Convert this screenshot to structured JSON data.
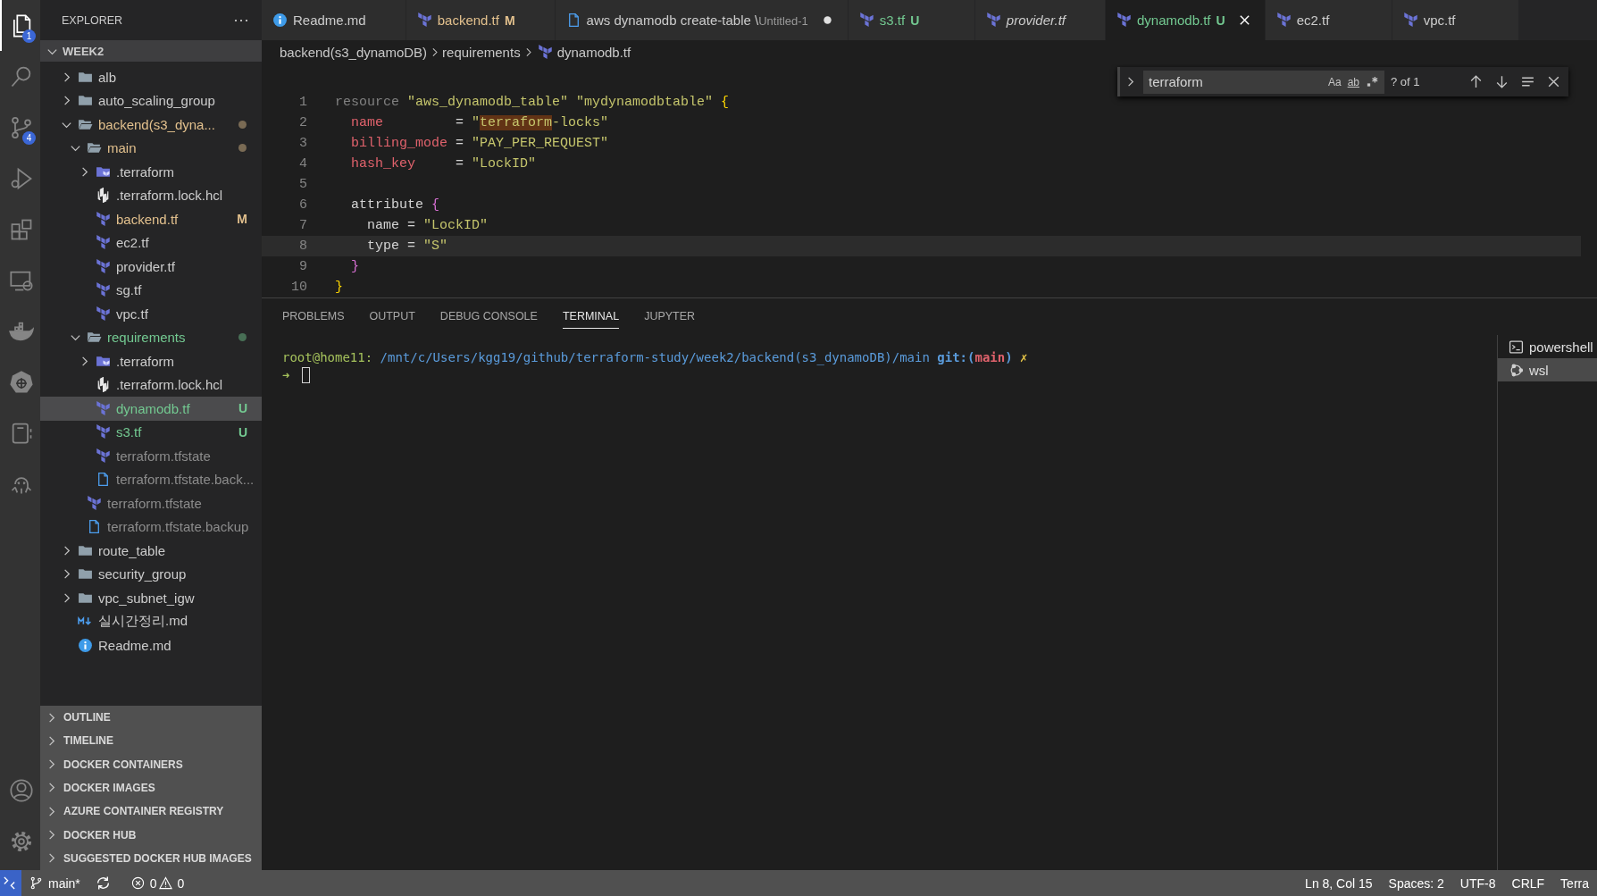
{
  "activity_bar": {
    "items": [
      {
        "kind": "explorer",
        "selected": true,
        "badge": "1"
      },
      {
        "kind": "search",
        "selected": false
      },
      {
        "kind": "source-control",
        "selected": false,
        "badge": "4"
      },
      {
        "kind": "run",
        "selected": false
      },
      {
        "kind": "extensions",
        "selected": false
      },
      {
        "kind": "remote",
        "selected": false
      },
      {
        "kind": "docker",
        "selected": false
      },
      {
        "kind": "kubernetes",
        "selected": false
      },
      {
        "kind": "notebook",
        "selected": false
      },
      {
        "kind": "octopus",
        "selected": false
      }
    ],
    "bottom": [
      {
        "kind": "account"
      },
      {
        "kind": "settings"
      }
    ]
  },
  "sidebar": {
    "title": "EXPLORER",
    "more": "···",
    "root": {
      "label": "WEEK2",
      "expanded": true
    },
    "tree": [
      {
        "label": "alb",
        "kind": "folder",
        "expanded": false,
        "color": "#cccccc",
        "dot": false,
        "selected": false
      },
      {
        "label": "auto_scaling_group",
        "kind": "folder",
        "expanded": false,
        "color": "#cccccc",
        "dot": false,
        "selected": false
      },
      {
        "label": "backend(s3_dyna...",
        "kind": "folder",
        "expanded": true,
        "color": "#e2c08d",
        "dot": true,
        "selected": false,
        "children": [
          {
            "label": "main",
            "kind": "folder",
            "expanded": true,
            "color": "#e2c08d",
            "dot": true,
            "selected": false,
            "children": [
              {
                "label": ".terraform",
                "kind": "tf-folder",
                "expanded": false,
                "color": "#cccccc",
                "dot": false,
                "selected": false
              },
              {
                "label": ".terraform.lock.hcl",
                "kind": "hcl",
                "color": "#cccccc",
                "selected": false
              },
              {
                "label": "backend.tf",
                "kind": "tf",
                "color": "#e2c08d",
                "badge": "M",
                "selected": false
              },
              {
                "label": "ec2.tf",
                "kind": "tf",
                "color": "#cccccc",
                "selected": false
              },
              {
                "label": "provider.tf",
                "kind": "tf",
                "color": "#cccccc",
                "selected": false
              },
              {
                "label": "sg.tf",
                "kind": "tf",
                "color": "#cccccc",
                "selected": false
              },
              {
                "label": "vpc.tf",
                "kind": "tf",
                "color": "#cccccc",
                "selected": false
              }
            ]
          },
          {
            "label": "requirements",
            "kind": "folder",
            "expanded": true,
            "color": "#73c991",
            "dot": true,
            "selected": false,
            "children": [
              {
                "label": ".terraform",
                "kind": "tf-folder",
                "expanded": false,
                "color": "#cccccc",
                "dot": false,
                "selected": false
              },
              {
                "label": ".terraform.lock.hcl",
                "kind": "hcl",
                "color": "#cccccc",
                "selected": false
              },
              {
                "label": "dynamodb.tf",
                "kind": "tf",
                "color": "#73c991",
                "badge": "U",
                "selected": true
              },
              {
                "label": "s3.tf",
                "kind": "tf",
                "color": "#73c991",
                "badge": "U",
                "selected": false
              },
              {
                "label": "terraform.tfstate",
                "kind": "tf",
                "color": "#8c8c8c",
                "selected": false
              },
              {
                "label": "terraform.tfstate.back...",
                "kind": "file",
                "color": "#8c8c8c",
                "selected": false
              }
            ]
          },
          {
            "label": "terraform.tfstate",
            "kind": "tf",
            "color": "#8c8c8c",
            "selected": false
          },
          {
            "label": "terraform.tfstate.backup",
            "kind": "file",
            "color": "#8c8c8c",
            "selected": false
          }
        ]
      },
      {
        "label": "route_table",
        "kind": "folder",
        "expanded": false,
        "color": "#cccccc",
        "dot": false,
        "selected": false
      },
      {
        "label": "security_group",
        "kind": "folder",
        "expanded": false,
        "color": "#cccccc",
        "dot": false,
        "selected": false
      },
      {
        "label": "vpc_subnet_igw",
        "kind": "folder",
        "expanded": false,
        "color": "#cccccc",
        "dot": false,
        "selected": false
      },
      {
        "label": "실시간정리.md",
        "kind": "markdown",
        "color": "#cccccc",
        "selected": false
      },
      {
        "label": "Readme.md",
        "kind": "info",
        "color": "#cccccc",
        "selected": false
      }
    ],
    "sections": [
      {
        "label": "OUTLINE",
        "expanded": false
      },
      {
        "label": "TIMELINE",
        "expanded": false
      },
      {
        "label": "DOCKER CONTAINERS",
        "expanded": false
      },
      {
        "label": "DOCKER IMAGES",
        "expanded": false
      },
      {
        "label": "AZURE CONTAINER REGISTRY",
        "expanded": false
      },
      {
        "label": "DOCKER HUB",
        "expanded": false
      },
      {
        "label": "SUGGESTED DOCKER HUB IMAGES",
        "expanded": false
      }
    ]
  },
  "tabs": [
    {
      "label": "Readme.md",
      "kind": "info",
      "color": "#cccccc",
      "selected": false,
      "dirty": false,
      "preview": false
    },
    {
      "label": "backend.tf",
      "kind": "tf",
      "color": "#e2c08d",
      "badge": "M",
      "selected": false,
      "dirty": false,
      "preview": false
    },
    {
      "label": "aws dynamodb create-table \\",
      "description": "Untitled-1",
      "kind": "file",
      "color": "#cccccc",
      "selected": false,
      "dirty": true,
      "preview": false
    },
    {
      "label": "s3.tf",
      "kind": "tf",
      "color": "#73c991",
      "badge": "U",
      "selected": false,
      "dirty": false,
      "preview": false
    },
    {
      "label": "provider.tf",
      "kind": "tf",
      "color": "#cccccc",
      "selected": false,
      "dirty": false,
      "preview": true
    },
    {
      "label": "dynamodb.tf",
      "kind": "tf",
      "color": "#73c991",
      "badge": "U",
      "selected": true,
      "dirty": false,
      "preview": false
    },
    {
      "label": "ec2.tf",
      "kind": "tf",
      "color": "#cccccc",
      "selected": false,
      "dirty": false,
      "preview": false
    },
    {
      "label": "vpc.tf",
      "kind": "tf",
      "color": "#cccccc",
      "selected": false,
      "dirty": false,
      "preview": false
    }
  ],
  "breadcrumb": [
    {
      "label": "backend(s3_dynamoDB)",
      "kind": "folder"
    },
    {
      "label": "requirements",
      "kind": "folder"
    },
    {
      "label": "dynamodb.tf",
      "kind": "tf"
    }
  ],
  "find": {
    "value": "terraform",
    "options": [
      {
        "label": "Aa",
        "kind": "case"
      },
      {
        "label": "ab",
        "kind": "word"
      }
    ],
    "count": "? of 1"
  },
  "editor": {
    "lines": [
      {
        "number": "1",
        "current": false,
        "tokens": [
          {
            "text": "resource",
            "kind": "keyword"
          },
          {
            "text": " \"aws_dynamodb_table\" \"mydynamodbtable\"",
            "kind": "string"
          },
          {
            "text": " {",
            "kind": "bracket1"
          }
        ]
      },
      {
        "number": "2",
        "current": false,
        "tokens": [
          {
            "text": "  name",
            "kind": "property"
          },
          {
            "text": "         = ",
            "kind": "plain"
          },
          {
            "text": "\"",
            "kind": "string"
          },
          {
            "text": "terraform",
            "kind": "match"
          },
          {
            "text": "-locks\"",
            "kind": "string"
          }
        ]
      },
      {
        "number": "3",
        "current": false,
        "tokens": [
          {
            "text": "  billing_mode",
            "kind": "property"
          },
          {
            "text": " = ",
            "kind": "plain"
          },
          {
            "text": "\"PAY_PER_REQUEST\"",
            "kind": "string"
          }
        ]
      },
      {
        "number": "4",
        "current": false,
        "tokens": [
          {
            "text": "  hash_key",
            "kind": "property"
          },
          {
            "text": "     = ",
            "kind": "plain"
          },
          {
            "text": "\"LockID\"",
            "kind": "string"
          }
        ]
      },
      {
        "number": "5",
        "current": false
      },
      {
        "number": "6",
        "current": false,
        "tokens": [
          {
            "text": "  attribute ",
            "kind": "plain"
          },
          {
            "text": "{",
            "kind": "bracket2"
          }
        ]
      },
      {
        "number": "7",
        "current": false,
        "tokens": [
          {
            "text": "    name = ",
            "kind": "plain"
          },
          {
            "text": "\"LockID\"",
            "kind": "string"
          }
        ]
      },
      {
        "number": "8",
        "current": true,
        "tokens": [
          {
            "text": "    type = ",
            "kind": "plain"
          },
          {
            "text": "\"S\"",
            "kind": "string"
          }
        ]
      },
      {
        "number": "9",
        "current": false,
        "tokens": [
          {
            "text": "  }",
            "kind": "bracket2"
          }
        ]
      },
      {
        "number": "10",
        "current": false,
        "tokens": [
          {
            "text": "}",
            "kind": "bracket1"
          }
        ]
      }
    ]
  },
  "panel": {
    "tabs": [
      {
        "label": "PROBLEMS",
        "selected": false
      },
      {
        "label": "OUTPUT",
        "selected": false
      },
      {
        "label": "DEBUG CONSOLE",
        "selected": false
      },
      {
        "label": "TERMINAL",
        "selected": true
      },
      {
        "label": "JUPYTER",
        "selected": false
      }
    ],
    "terminal": {
      "prompt_line": [
        {
          "text": "root@home11:",
          "kind": "user"
        },
        {
          "text": " /mnt/c/Users/kgg19/github/terraform-study/week2/backend(s3_dynamoDB)/main ",
          "kind": "path"
        },
        {
          "text": "git:(",
          "kind": "git"
        },
        {
          "text": "main",
          "kind": "branch"
        },
        {
          "text": ")",
          "kind": "git"
        },
        {
          "text": " ✗",
          "kind": "dirty"
        }
      ],
      "arrow": "➜"
    },
    "terminals": [
      {
        "label": "powershell",
        "kind": "powershell",
        "selected": false
      },
      {
        "label": "wsl",
        "kind": "wsl",
        "selected": true
      }
    ]
  },
  "status_bar": {
    "branch": "main*",
    "errors": "0",
    "warnings": "0",
    "right": [
      "Ln 8, Col 15",
      "Spaces: 2",
      "UTF-8",
      "CRLF",
      "Terra"
    ]
  }
}
